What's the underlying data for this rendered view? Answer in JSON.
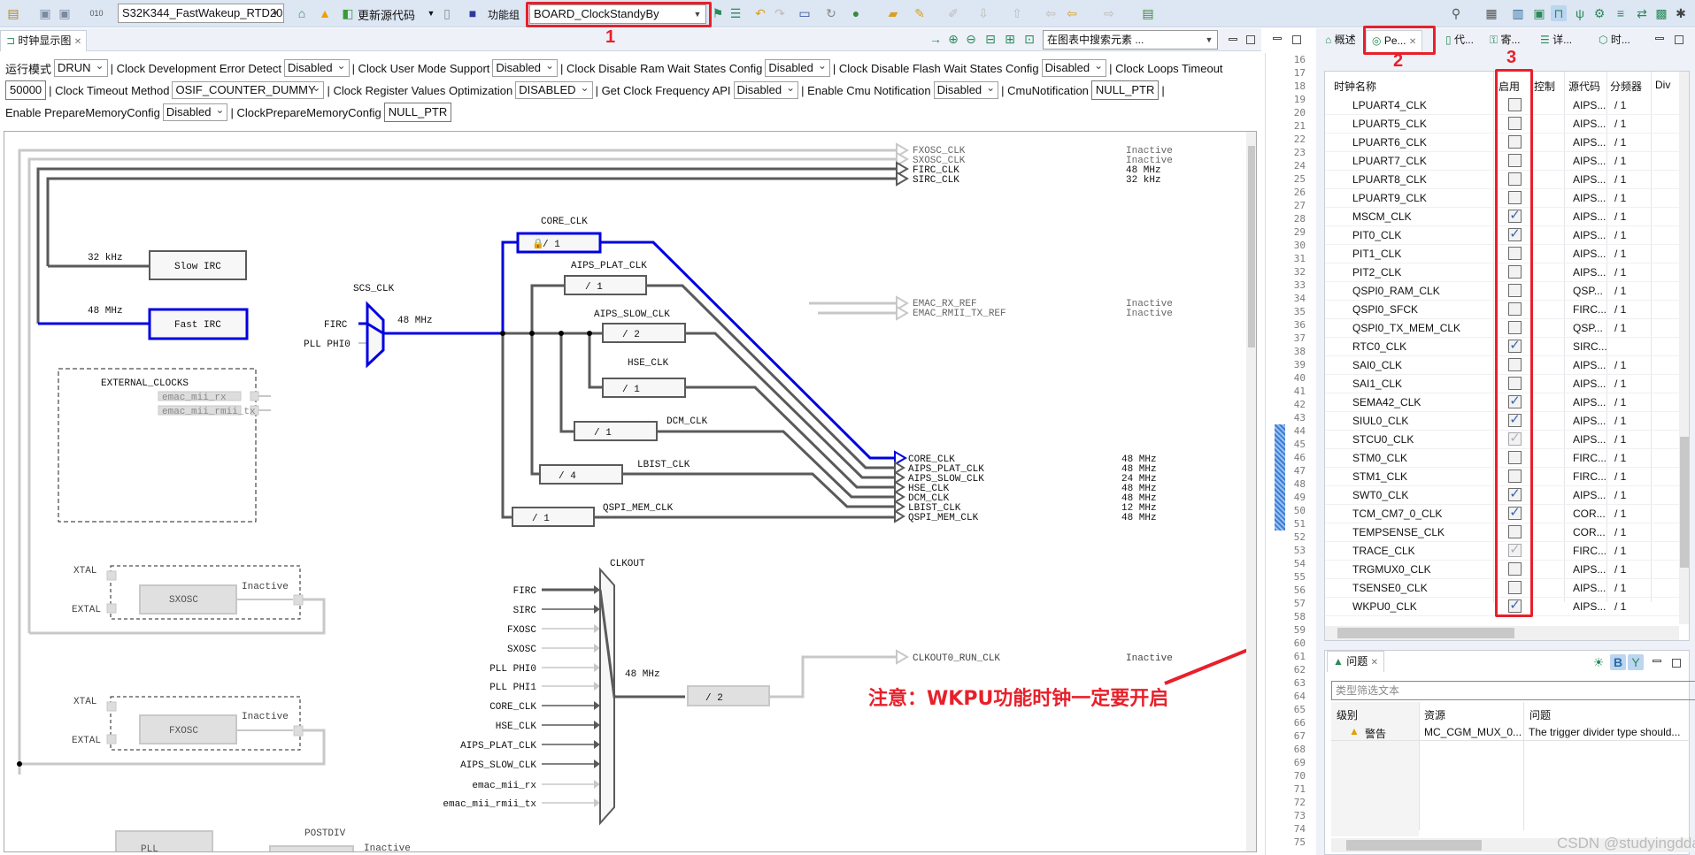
{
  "toolbar": {
    "project": "S32K344_FastWakeup_RTD20",
    "update_code": "更新源代码",
    "function_group_label": "功能组",
    "function_group": "BOARD_ClockStandyBy"
  },
  "left_editor": {
    "tab": "时钟显示图",
    "search_placeholder": "在图表中搜索元素 ..."
  },
  "config": {
    "run_mode_label": "运行模式",
    "run_mode": "DRUN",
    "dev_error_label": "| Clock Development Error Detect",
    "dev_error": "Disabled",
    "user_mode_label": "| Clock User Mode Support",
    "user_mode": "Disabled",
    "ram_wait_label": "| Clock Disable Ram Wait States Config",
    "ram_wait": "Disabled",
    "flash_wait_label": "| Clock Disable Flash Wait States Config",
    "flash_wait": "Disabled",
    "loops_timeout_label": "| Clock Loops Timeout",
    "loops_timeout": "50000",
    "timeout_method_label": "| Clock Timeout Method",
    "timeout_method": "OSIF_COUNTER_DUMMY",
    "reg_opt_label": "| Clock Register Values Optimization",
    "reg_opt": "DISABLED",
    "get_freq_label": "| Get Clock Frequency API",
    "get_freq": "Disabled",
    "cmu_notif_enable_label": "| Enable Cmu Notification",
    "cmu_notif_enable": "Disabled",
    "cmu_notif_label": "| CmuNotification",
    "cmu_notif": "NULL_PTR",
    "sep": "|",
    "prep_mem_enable_label": "Enable PrepareMemoryConfig",
    "prep_mem_enable": "Disabled",
    "prep_mem_label": "| ClockPrepareMemoryConfig",
    "prep_mem": "NULL_PTR"
  },
  "diagram": {
    "top_outputs": [
      {
        "label": "FXOSC_CLK",
        "value": "Inactive"
      },
      {
        "label": "SXOSC_CLK",
        "value": "Inactive"
      },
      {
        "label": "FIRC_CLK",
        "value": "48 MHz"
      },
      {
        "label": "SIRC_CLK",
        "value": "32 kHz"
      }
    ],
    "slow_irc": {
      "label": "Slow IRC",
      "freq": "32 kHz"
    },
    "fast_irc": {
      "label": "Fast IRC",
      "freq": "48 MHz"
    },
    "scs": {
      "label": "SCS_CLK",
      "inputs": [
        "FIRC",
        "PLL PHI0"
      ],
      "freq": "48 MHz"
    },
    "dividers": [
      {
        "label": "CORE_CLK",
        "div": "/ 1"
      },
      {
        "label": "AIPS_PLAT_CLK",
        "div": "/ 1"
      },
      {
        "label": "AIPS_SLOW_CLK",
        "div": "/ 2"
      },
      {
        "label": "HSE_CLK",
        "div": "/ 1"
      },
      {
        "label": "DCM_CLK",
        "div": "/ 1"
      },
      {
        "label": "LBIST_CLK",
        "div": "/ 4"
      },
      {
        "label": "QSPI_MEM_CLK",
        "div": "/ 1"
      }
    ],
    "outputs": [
      {
        "label": "CORE_CLK",
        "value": "48 MHz"
      },
      {
        "label": "AIPS_PLAT_CLK",
        "value": "48 MHz"
      },
      {
        "label": "AIPS_SLOW_CLK",
        "value": "24 MHz"
      },
      {
        "label": "HSE_CLK",
        "value": "48 MHz"
      },
      {
        "label": "DCM_CLK",
        "value": "48 MHz"
      },
      {
        "label": "LBIST_CLK",
        "value": "12 MHz"
      },
      {
        "label": "QSPI_MEM_CLK",
        "value": "48 MHz"
      }
    ],
    "emac_outputs": [
      {
        "label": "EMAC_RX_REF",
        "value": "Inactive"
      },
      {
        "label": "EMAC_RMII_TX_REF",
        "value": "Inactive"
      }
    ],
    "external": {
      "label": "EXTERNAL_CLOCKS",
      "items": [
        "emac_mii_rx",
        "emac_mii_rmii_tx"
      ]
    },
    "sxosc": {
      "label": "SXOSC",
      "xtal": "XTAL",
      "extal": "EXTAL",
      "status": "Inactive"
    },
    "fxosc": {
      "label": "FXOSC",
      "xtal": "XTAL",
      "extal": "EXTAL",
      "status": "Inactive"
    },
    "clkout": {
      "label": "CLKOUT",
      "inputs": [
        "FIRC",
        "SIRC",
        "FXOSC",
        "SXOSC",
        "PLL PHI0",
        "PLL PHI1",
        "CORE_CLK",
        "HSE_CLK",
        "AIPS_PLAT_CLK",
        "AIPS_SLOW_CLK",
        "emac_mii_rx",
        "emac_mii_rmii_tx"
      ],
      "freq": "48 MHz",
      "div": "/ 2",
      "output": "CLKOUT0_RUN_CLK",
      "status": "Inactive"
    },
    "pll": {
      "label": "PLL",
      "postdiv": "POSTDIV",
      "status": "Inactive"
    }
  },
  "right_panel": {
    "tabs": [
      "概述",
      "Pe...",
      "代...",
      "寄...",
      "详...",
      "时..."
    ],
    "columns": [
      "时钟名称",
      "启用",
      "控制",
      "源代码",
      "分频器",
      "Div"
    ],
    "rows": [
      {
        "name": "LPUART4_CLK",
        "enabled": false,
        "source": "AIPS...",
        "divider": "/ 1"
      },
      {
        "name": "LPUART5_CLK",
        "enabled": false,
        "source": "AIPS...",
        "divider": "/ 1"
      },
      {
        "name": "LPUART6_CLK",
        "enabled": false,
        "source": "AIPS...",
        "divider": "/ 1"
      },
      {
        "name": "LPUART7_CLK",
        "enabled": false,
        "source": "AIPS...",
        "divider": "/ 1"
      },
      {
        "name": "LPUART8_CLK",
        "enabled": false,
        "source": "AIPS...",
        "divider": "/ 1"
      },
      {
        "name": "LPUART9_CLK",
        "enabled": false,
        "source": "AIPS...",
        "divider": "/ 1"
      },
      {
        "name": "MSCM_CLK",
        "enabled": true,
        "source": "AIPS...",
        "divider": "/ 1"
      },
      {
        "name": "PIT0_CLK",
        "enabled": true,
        "source": "AIPS...",
        "divider": "/ 1"
      },
      {
        "name": "PIT1_CLK",
        "enabled": false,
        "source": "AIPS...",
        "divider": "/ 1"
      },
      {
        "name": "PIT2_CLK",
        "enabled": false,
        "source": "AIPS...",
        "divider": "/ 1"
      },
      {
        "name": "QSPI0_RAM_CLK",
        "enabled": false,
        "source": "QSP...",
        "divider": "/ 1"
      },
      {
        "name": "QSPI0_SFCK",
        "enabled": false,
        "source": "FIRC...",
        "divider": "/ 1"
      },
      {
        "name": "QSPI0_TX_MEM_CLK",
        "enabled": false,
        "source": "QSP...",
        "divider": "/ 1"
      },
      {
        "name": "RTC0_CLK",
        "enabled": true,
        "source": "SIRC...",
        "divider": ""
      },
      {
        "name": "SAI0_CLK",
        "enabled": false,
        "source": "AIPS...",
        "divider": "/ 1"
      },
      {
        "name": "SAI1_CLK",
        "enabled": false,
        "source": "AIPS...",
        "divider": "/ 1"
      },
      {
        "name": "SEMA42_CLK",
        "enabled": true,
        "source": "AIPS...",
        "divider": "/ 1"
      },
      {
        "name": "SIUL0_CLK",
        "enabled": true,
        "source": "AIPS...",
        "divider": "/ 1"
      },
      {
        "name": "STCU0_CLK",
        "enabled": true,
        "locked": true,
        "source": "AIPS...",
        "divider": "/ 1"
      },
      {
        "name": "STM0_CLK",
        "enabled": false,
        "source": "FIRC...",
        "divider": "/ 1"
      },
      {
        "name": "STM1_CLK",
        "enabled": false,
        "source": "FIRC...",
        "divider": "/ 1"
      },
      {
        "name": "SWT0_CLK",
        "enabled": true,
        "source": "AIPS...",
        "divider": "/ 1"
      },
      {
        "name": "TCM_CM7_0_CLK",
        "enabled": true,
        "source": "COR...",
        "divider": "/ 1"
      },
      {
        "name": "TEMPSENSE_CLK",
        "enabled": false,
        "source": "COR...",
        "divider": "/ 1"
      },
      {
        "name": "TRACE_CLK",
        "enabled": true,
        "locked": true,
        "source": "FIRC...",
        "divider": "/ 1"
      },
      {
        "name": "TRGMUX0_CLK",
        "enabled": false,
        "source": "AIPS...",
        "divider": "/ 1"
      },
      {
        "name": "TSENSE0_CLK",
        "enabled": false,
        "source": "AIPS...",
        "divider": "/ 1"
      },
      {
        "name": "WKPU0_CLK",
        "enabled": true,
        "source": "AIPS...",
        "divider": "/ 1"
      }
    ]
  },
  "problems": {
    "tab": "问题",
    "filter_placeholder": "类型筛选文本",
    "columns": [
      "级别",
      "资源",
      "问题"
    ],
    "rows": [
      {
        "level": "警告",
        "resource": "MC_CGM_MUX_0...",
        "issue": "The trigger divider type should..."
      }
    ]
  },
  "line_numbers": {
    "first": 16,
    "last": 75
  },
  "annotations": {
    "markers": [
      "1",
      "2",
      "3"
    ],
    "note": "注意：WKPU功能时钟一定要开启",
    "color": "#e8202a"
  },
  "watermark": "CSDN @studyingdda",
  "colors": {
    "active_path": "#0000e0",
    "wire": "#5a5a5a",
    "inactive_wire": "#c8c8c8"
  }
}
